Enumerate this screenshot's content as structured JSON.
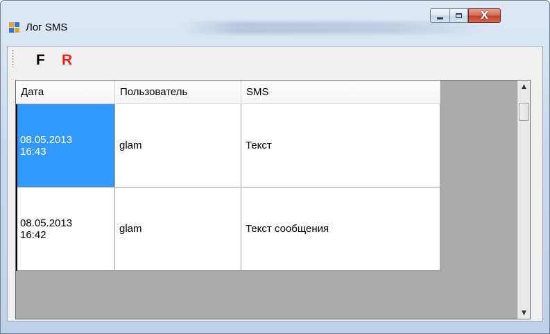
{
  "window": {
    "title": "Лог SMS",
    "minimize_icon": "minimize-icon",
    "maximize_icon": "maximize-icon",
    "close_icon": "close-icon",
    "close_glyph": "X"
  },
  "toolbar": {
    "buttons": [
      {
        "label": "F",
        "color": "#000000"
      },
      {
        "label": "R",
        "color": "#ff1a1a"
      }
    ]
  },
  "grid": {
    "columns": [
      "Дата",
      "Пользователь",
      "SMS"
    ],
    "rows": [
      {
        "date": "08.05.2013\n16:43",
        "user": "glam",
        "sms": "Текст",
        "selected": true
      },
      {
        "date": "08.05.2013\n16:42",
        "user": "glam",
        "sms": "Текст сообщения",
        "selected": false
      }
    ],
    "selection_color": "#3399ff"
  },
  "scrollbar": {
    "up_icon": "scroll-up-arrow-icon",
    "down_icon": "scroll-down-arrow-icon"
  }
}
